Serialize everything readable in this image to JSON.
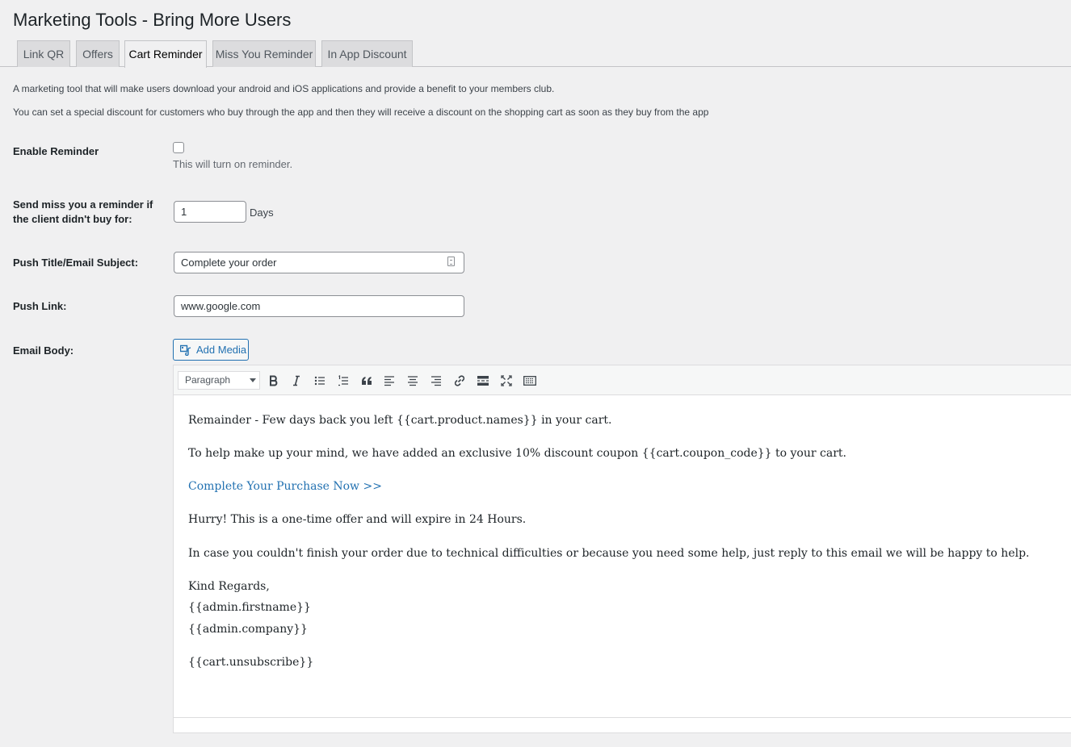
{
  "page": {
    "title": "Marketing Tools - Bring More Users"
  },
  "tabs": [
    {
      "label": "Link QR"
    },
    {
      "label": "Offers"
    },
    {
      "label": "Cart Reminder",
      "active": true
    },
    {
      "label": "Miss You Reminder"
    },
    {
      "label": "In App Discount"
    }
  ],
  "description": {
    "line1": "A marketing tool that will make users download your android and iOS applications and provide a benefit to your members club.",
    "line2": "You can set a special discount for customers who buy through the app and then they will receive a discount on the shopping cart as soon as they buy from the app"
  },
  "form": {
    "enable_reminder": {
      "label": "Enable Reminder",
      "checked": false,
      "hint": "This will turn on reminder."
    },
    "days": {
      "label_line1": "Send miss you a reminder if",
      "label_line2": "the client didn't buy for:",
      "value": "1",
      "unit": "Days"
    },
    "push_title": {
      "label": "Push Title/Email Subject:",
      "value": "Complete your order"
    },
    "push_link": {
      "label": "Push Link:",
      "value": "www.google.com"
    },
    "email_body": {
      "label": "Email Body:"
    }
  },
  "editor": {
    "add_media_label": "Add Media",
    "format_select": "Paragraph",
    "toolbar_buttons": [
      "bold",
      "italic",
      "bullet-list",
      "numbered-list",
      "blockquote",
      "align-left",
      "align-center",
      "align-right",
      "link",
      "read-more",
      "fullscreen",
      "toolbar-toggle"
    ],
    "body": {
      "p1": "Remainder - Few days back you left {{cart.product.names}} in your cart.",
      "p2": "To help make up your mind, we have added an exclusive 10% discount coupon {{cart.coupon_code}} to your cart.",
      "link": "Complete Your Purchase Now >>",
      "p3": "Hurry! This is a one-time offer and will expire in 24 Hours.",
      "p4": "In case you couldn't finish your order due to technical difficulties or because you need some help, just reply to this email we will be happy to help.",
      "regards": "Kind Regards,",
      "firstname": "{{admin.firstname}}",
      "company": "{{admin.company}}",
      "unsubscribe": "{{cart.unsubscribe}}"
    }
  },
  "colors": {
    "link": "#2271b1",
    "background": "#f0f0f1"
  }
}
